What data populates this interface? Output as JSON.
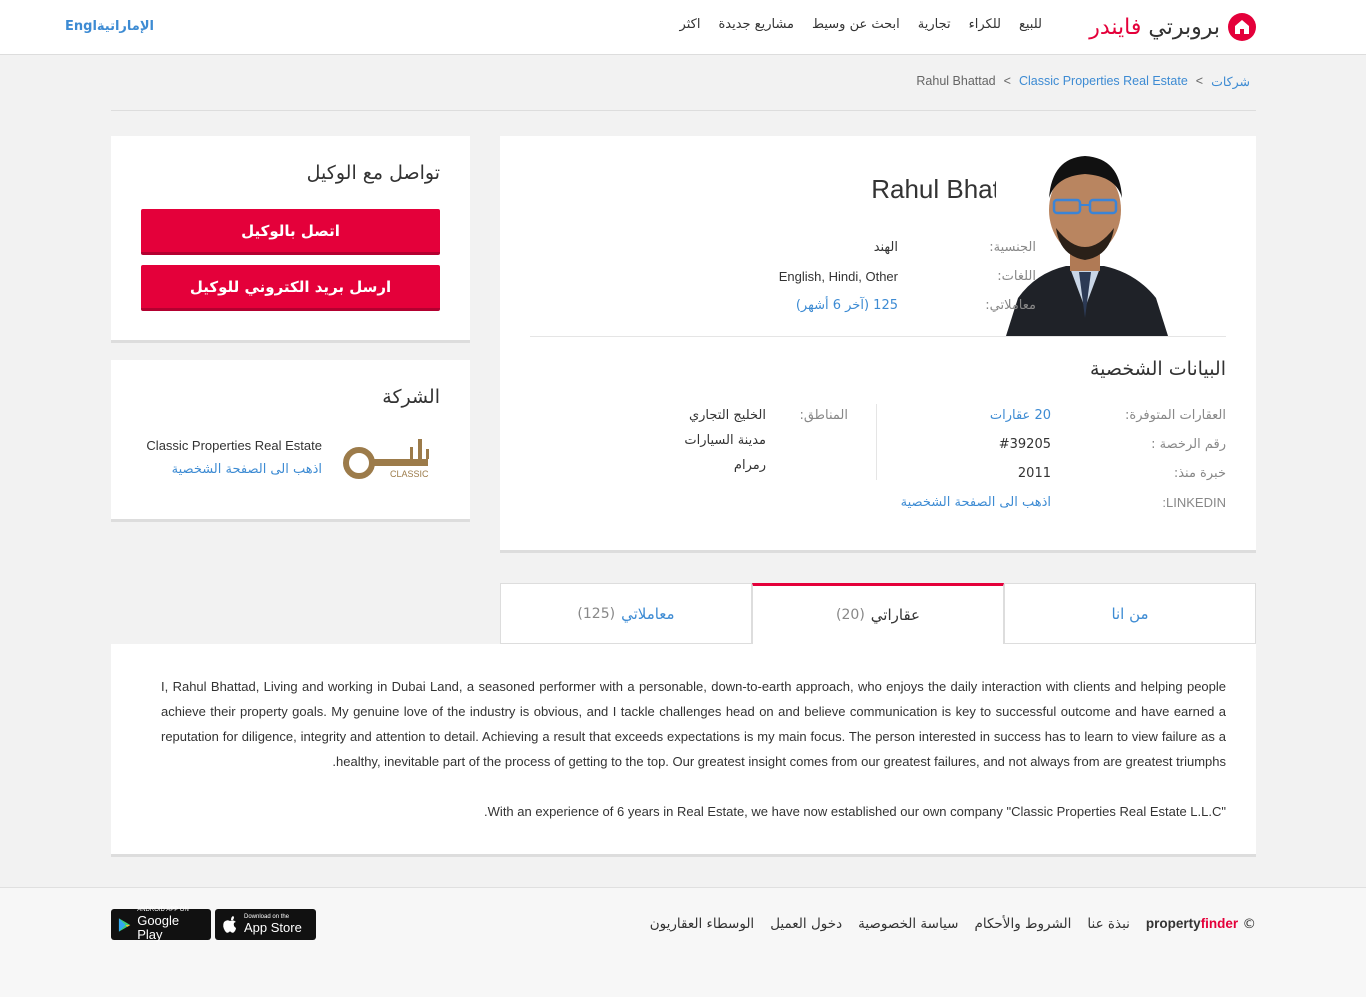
{
  "header": {
    "logo_text_main": "بروبرتي ",
    "logo_text_accent": "فايندر",
    "nav": [
      "للبيع",
      "للكراء",
      "تجارية",
      "ابحث عن وسيط",
      "مشاريع جديدة",
      "اكثر"
    ],
    "lang_switch": "Englالإماراتية"
  },
  "breadcrumb": {
    "items": [
      "شركات",
      "Classic Properties Real Estate",
      "Rahul Bhattad"
    ],
    "separator": ">"
  },
  "profile": {
    "name": "Rahul Bhattad",
    "nationality_label": "الجنسية:",
    "nationality_value": "الهند",
    "languages_label": "اللغات:",
    "languages_value": "English, Hindi, Other",
    "transactions_label": "معاملاتي:",
    "transactions_value": "125 (آخر 6 أشهر)"
  },
  "personal": {
    "title": "البيانات الشخصية",
    "properties_label": "العقارات المتوفرة:",
    "properties_value": "20 عقارات",
    "license_label": "رقم الرخصة :",
    "license_value": "#39205",
    "experience_label": "خبرة منذ:",
    "experience_value": "2011",
    "linkedin_label": "LINKEDIN:",
    "linkedin_value": "اذهب الى الصفحة الشخصية",
    "areas_label": "المناطق:",
    "areas": [
      "الخليج التجاري",
      "مدينة السيارات",
      "رمرام"
    ]
  },
  "contact": {
    "title": "تواصل مع الوكيل",
    "call_button": "اتصل بالوكيل",
    "email_button": "ارسل بريد الكتروني للوكيل"
  },
  "company": {
    "title": "الشركة",
    "name": "Classic Properties Real Estate",
    "profile_link": "اذهب الى الصفحة الشخصية",
    "logo_text": "CLASSIC"
  },
  "tabs": [
    {
      "label": "من انا",
      "count": ""
    },
    {
      "label": "عقاراتي",
      "count": "(20)"
    },
    {
      "label": "معاملاتي",
      "count": "(125)"
    }
  ],
  "about": {
    "paragraph1": "I, Rahul Bhattad, Living and working in Dubai Land, a seasoned performer with a personable, down-to-earth approach, who enjoys the daily interaction with clients and helping people achieve their property goals. My genuine love of the industry is obvious, and I tackle challenges head on and believe communication is key to successful outcome and have earned a reputation for diligence, integrity and attention to detail. Achieving a result that exceeds expectations is my main focus. The person interested in success has to learn to view failure as a healthy, inevitable part of the process of getting to the top. Our greatest insight comes from our greatest failures, and not always from are greatest triumphs.",
    "paragraph2": "\"With an experience of 6 years in Real Estate, we have now established our own company \"Classic Properties Real Estate L.L.C."
  },
  "footer": {
    "copyright_symbol": "©",
    "brand_main": "property",
    "brand_accent": "finder",
    "links": [
      "نبذة عنا",
      "الشروط والأحكام",
      "سياسة الخصوصية",
      "دخول العميل",
      "الوسطاء العقاريون"
    ],
    "appstore_small": "Download on the",
    "appstore_big": "App Store",
    "googleplay_small": "ANDROID APP ON",
    "googleplay_big": "Google Play"
  },
  "colors": {
    "accent": "#e4003a",
    "link": "#3d8bd3",
    "background": "#f2f2f2"
  }
}
